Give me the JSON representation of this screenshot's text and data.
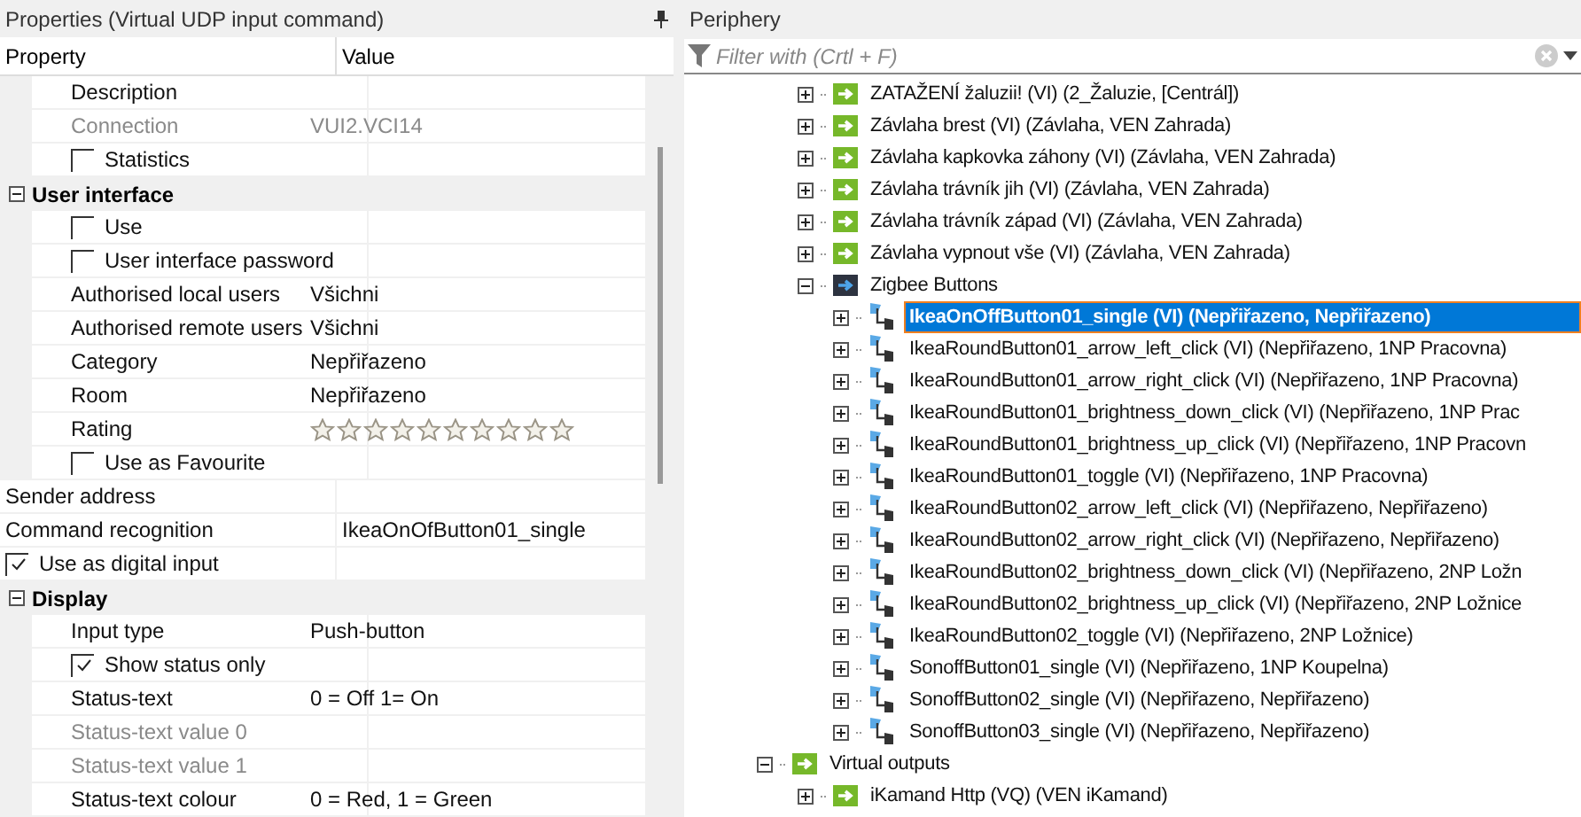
{
  "properties": {
    "title": "Properties (Virtual UDP input command)",
    "columns": [
      "Property",
      "Value"
    ],
    "rows": [
      {
        "kind": "continued",
        "children": [
          {
            "kind": "field",
            "label": "Description",
            "disabled": false
          },
          {
            "kind": "field",
            "label": "Connection",
            "value": "VUI2.VCI14",
            "disabled": true
          },
          {
            "kind": "checkbox",
            "label": "Statistics",
            "checked": false
          }
        ]
      },
      {
        "kind": "group",
        "label": "User interface",
        "expanded": true,
        "children": [
          {
            "kind": "checkbox",
            "label": "Use",
            "checked": false
          },
          {
            "kind": "checkbox",
            "label": "User interface password",
            "checked": false
          },
          {
            "kind": "field",
            "label": "Authorised local users",
            "value": "Všichni",
            "disabled": false
          },
          {
            "kind": "field",
            "label": "Authorised remote users",
            "value": "Všichni",
            "disabled": false
          },
          {
            "kind": "field",
            "label": "Category",
            "value": "Nepřiřazeno",
            "disabled": false
          },
          {
            "kind": "field",
            "label": "Room",
            "value": "Nepřiřazeno",
            "disabled": false
          },
          {
            "kind": "stars",
            "label": "Rating",
            "stars": 0
          },
          {
            "kind": "checkbox",
            "label": "Use as Favourite",
            "checked": false
          }
        ]
      },
      {
        "kind": "field",
        "label": "Sender address",
        "disabled": false
      },
      {
        "kind": "field",
        "label": "Command recognition",
        "value": "IkeaOnOfButton01_single",
        "disabled": false
      },
      {
        "kind": "checkbox",
        "label": "Use as digital input",
        "checked": true
      },
      {
        "kind": "group",
        "label": "Display",
        "expanded": true,
        "children": [
          {
            "kind": "field",
            "label": "Input type",
            "value": "Push-button",
            "disabled": false
          },
          {
            "kind": "checkbox",
            "label": "Show status only",
            "checked": true
          },
          {
            "kind": "field",
            "label": "Status-text",
            "value": "0 = Off 1= On",
            "disabled": false
          },
          {
            "kind": "field",
            "label": "Status-text value 0",
            "disabled": true
          },
          {
            "kind": "field",
            "label": "Status-text value 1",
            "disabled": true
          },
          {
            "kind": "field",
            "label": "Status-text colour",
            "value": "0 = Red, 1 = Green",
            "disabled": false
          }
        ]
      }
    ]
  },
  "periphery": {
    "title": "Periphery",
    "filter": {
      "placeholder": "Filter with (Crtl + F)"
    },
    "tree": [
      {
        "kind": "continued",
        "children": [
          {
            "kind": "output",
            "label": "ZATAŽENÍ žaluzii! (VI) (2_Žaluzie, [Centrál])",
            "expanded": false,
            "selected": false
          },
          {
            "kind": "output",
            "label": "Závlaha brest (VI) (Závlaha, VEN Zahrada)",
            "expanded": false,
            "selected": false
          },
          {
            "kind": "output",
            "label": "Závlaha kapkovka záhony (VI) (Závlaha, VEN Zahrada)",
            "expanded": false,
            "selected": false
          },
          {
            "kind": "output",
            "label": "Závlaha trávník jih (VI) (Závlaha, VEN Zahrada)",
            "expanded": false,
            "selected": false
          },
          {
            "kind": "output",
            "label": "Závlaha trávník západ (VI) (Závlaha, VEN Zahrada)",
            "expanded": false,
            "selected": false
          },
          {
            "kind": "output",
            "label": "Závlaha vypnout vše (VI) (Závlaha, VEN Zahrada)",
            "expanded": false,
            "selected": false
          },
          {
            "kind": "folder",
            "label": "Zigbee Buttons",
            "expanded": true,
            "selected": false,
            "children": [
              {
                "kind": "button",
                "label": "IkeaOnOffButton01_single (VI) (Nepřiřazeno, Nepřiřazeno)",
                "expanded": false,
                "selected": true
              },
              {
                "kind": "button",
                "label": "IkeaRoundButton01_arrow_left_click (VI) (Nepřiřazeno, 1NP Pracovna)",
                "expanded": false,
                "selected": false
              },
              {
                "kind": "button",
                "label": "IkeaRoundButton01_arrow_right_click (VI) (Nepřiřazeno, 1NP Pracovna)",
                "expanded": false,
                "selected": false
              },
              {
                "kind": "button",
                "label": "IkeaRoundButton01_brightness_down_click (VI) (Nepřiřazeno, 1NP Prac",
                "expanded": false,
                "selected": false
              },
              {
                "kind": "button",
                "label": "IkeaRoundButton01_brightness_up_click (VI) (Nepřiřazeno, 1NP Pracovn",
                "expanded": false,
                "selected": false
              },
              {
                "kind": "button",
                "label": "IkeaRoundButton01_toggle (VI) (Nepřiřazeno, 1NP Pracovna)",
                "expanded": false,
                "selected": false
              },
              {
                "kind": "button",
                "label": "IkeaRoundButton02_arrow_left_click (VI) (Nepřiřazeno, Nepřiřazeno)",
                "expanded": false,
                "selected": false
              },
              {
                "kind": "button",
                "label": "IkeaRoundButton02_arrow_right_click (VI) (Nepřiřazeno, Nepřiřazeno)",
                "expanded": false,
                "selected": false
              },
              {
                "kind": "button",
                "label": "IkeaRoundButton02_brightness_down_click (VI) (Nepřiřazeno, 2NP Ložn",
                "expanded": false,
                "selected": false
              },
              {
                "kind": "button",
                "label": "IkeaRoundButton02_brightness_up_click (VI) (Nepřiřazeno, 2NP Ložnice",
                "expanded": false,
                "selected": false
              },
              {
                "kind": "button",
                "label": "IkeaRoundButton02_toggle (VI) (Nepřiřazeno, 2NP Ložnice)",
                "expanded": false,
                "selected": false
              },
              {
                "kind": "button",
                "label": "SonoffButton01_single (VI) (Nepřiřazeno, 1NP Koupelna)",
                "expanded": false,
                "selected": false
              },
              {
                "kind": "button",
                "label": "SonoffButton02_single (VI) (Nepřiřazeno, Nepřiřazeno)",
                "expanded": false,
                "selected": false
              },
              {
                "kind": "button",
                "label": "SonoffButton03_single (VI) (Nepřiřazeno, Nepřiřazeno)",
                "expanded": false,
                "selected": false
              }
            ]
          }
        ]
      },
      {
        "kind": "output",
        "label": "Virtual outputs",
        "expanded": true,
        "selected": false,
        "children": [
          {
            "kind": "output",
            "label": "iKamand Http (VQ) (VEN iKamand)",
            "expanded": false,
            "selected": false
          }
        ]
      }
    ]
  }
}
